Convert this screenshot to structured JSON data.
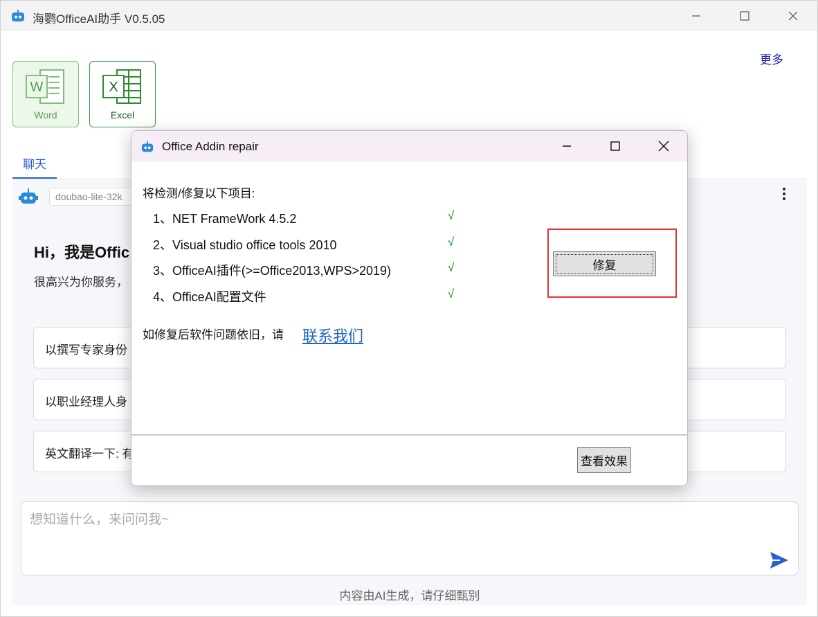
{
  "window": {
    "title": "海鹦OfficeAI助手 V0.5.05",
    "more_label": "更多"
  },
  "apps": [
    {
      "label": "Word",
      "icon": "word-icon"
    },
    {
      "label": "Excel",
      "icon": "excel-icon"
    }
  ],
  "tabs": [
    {
      "label": "聊天",
      "active": true
    }
  ],
  "chat": {
    "model_value": "doubao-lite-32k",
    "greeting_title": "Hi，我是Offic",
    "greeting_sub": "很高兴为你服务，",
    "suggestions": [
      "以撰写专家身份",
      "以职业经理人身",
      "英文翻译一下: 有"
    ],
    "input_placeholder": "想知道什么，来问问我~",
    "disclaimer": "内容由AI生成，请仔细甄别"
  },
  "dialog": {
    "title": "Office Addin repair",
    "heading": "将检测/修复以下项目:",
    "items": [
      {
        "label": "1、NET FrameWork 4.5.2",
        "status": "√"
      },
      {
        "label": "2、Visual studio office tools 2010",
        "status": "√"
      },
      {
        "label": "3、OfficeAI插件(>=Office2013,WPS>2019)",
        "status": "√"
      },
      {
        "label": "4、OfficeAI配置文件",
        "status": "√"
      }
    ],
    "help_text": "如修复后软件问题依旧，请",
    "contact_link": "联系我们",
    "repair_label": "修复",
    "view_label": "查看效果"
  },
  "colors": {
    "accent": "#2a5fd0",
    "link": "#1f64c8",
    "check": "#1a8a1a",
    "highlight": "#e8332a",
    "app_green": "#3a9a3a"
  }
}
